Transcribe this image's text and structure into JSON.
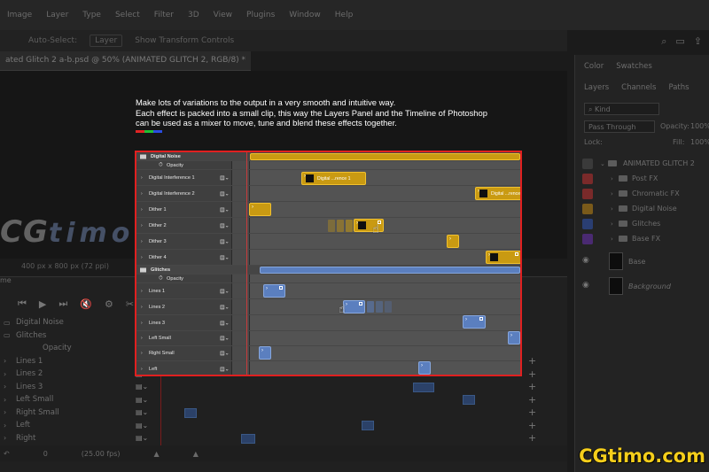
{
  "menubar": {
    "items": [
      "Image",
      "Layer",
      "Type",
      "Select",
      "Filter",
      "3D",
      "View",
      "Plugins",
      "Window",
      "Help"
    ]
  },
  "options_bar": {
    "auto_select": "Auto-Select:",
    "layer_select": "Layer",
    "show_transform": "Show Transform Controls"
  },
  "document": {
    "tab_title": "ated Glitch 2 a-b.psd @ 50% (ANIMATED GLITCH 2, RGB/8) *",
    "status": "400 px x 800 px (72 ppi)"
  },
  "left_watermark": {
    "cg": "CG",
    "timo": "timo"
  },
  "description": {
    "line1": "Make lots of variations to the output in a very smooth and intuitive way.",
    "line2": "Each effect is packed into a small clip, this way the Layers Panel and the Timeline of Photoshop",
    "line3": "can be used as a mixer to move, tune and blend these effects together.",
    "rgb_colors": [
      "#e02424",
      "#22c033",
      "#2a4de0"
    ]
  },
  "inset_timeline": {
    "rows": [
      {
        "label": "Digital Noise",
        "type": "group"
      },
      {
        "label": "Opacity",
        "type": "opacity"
      },
      {
        "label": "Digital Interference 1",
        "type": "layer"
      },
      {
        "label": "Digital Interference 2",
        "type": "layer"
      },
      {
        "label": "Dither 1",
        "type": "layer"
      },
      {
        "label": "Dither 2",
        "type": "layer"
      },
      {
        "label": "Dither 3",
        "type": "layer"
      },
      {
        "label": "Dither 4",
        "type": "layer"
      },
      {
        "label": "Glitches",
        "type": "group"
      },
      {
        "label": "Opacity",
        "type": "opacity"
      },
      {
        "label": "Lines 1",
        "type": "layer"
      },
      {
        "label": "Lines 2",
        "type": "layer"
      },
      {
        "label": "Lines 3",
        "type": "layer"
      },
      {
        "label": "Left Small",
        "type": "layer"
      },
      {
        "label": "Right Small",
        "type": "layer"
      },
      {
        "label": "Left",
        "type": "layer"
      }
    ],
    "clip_labels": {
      "di1": "Digital ...rence 1",
      "di2": "Digital ...rence"
    },
    "colors": {
      "yellow_clip": "#c99a12",
      "blue_clip": "#5b7fbf",
      "border": "#e02020"
    }
  },
  "bg_timeline": {
    "tab": "me",
    "rows": [
      {
        "label": "Digital Noise",
        "kind": "group"
      },
      {
        "label": "Glitches",
        "kind": "group"
      },
      {
        "label": "Opacity",
        "kind": "opacity"
      },
      {
        "label": "Lines 1",
        "kind": "layer"
      },
      {
        "label": "Lines 2",
        "kind": "layer"
      },
      {
        "label": "Lines 3",
        "kind": "layer"
      },
      {
        "label": "Left Small",
        "kind": "layer"
      },
      {
        "label": "Right Small",
        "kind": "layer"
      },
      {
        "label": "Left",
        "kind": "layer"
      },
      {
        "label": "Right",
        "kind": "layer"
      }
    ],
    "bottom": {
      "frame": "0",
      "fps": "(25.00 fps)"
    }
  },
  "right_panel": {
    "tabs_top": [
      "Color",
      "Swatches"
    ],
    "tabs": [
      "Layers",
      "Channels",
      "Paths"
    ],
    "kind": "Kind",
    "blend_mode": "Pass Through",
    "opacity_label": "Opacity:",
    "opacity_value": "100%",
    "lock_label": "Lock:",
    "fill_label": "Fill:",
    "fill_value": "100%",
    "group_name": "ANIMATED GLITCH 2",
    "layers": [
      {
        "name": "Post FX",
        "color": "#7a2a2a"
      },
      {
        "name": "Chromatic FX",
        "color": "#7a2a2a"
      },
      {
        "name": "Digital Noise",
        "color": "#7a5a1a"
      },
      {
        "name": "Glitches",
        "color": "#2a3e72"
      },
      {
        "name": "Base FX",
        "color": "#4a2a72"
      }
    ],
    "base_layers": [
      "Base",
      "Background"
    ]
  },
  "bottom_watermark": "CGtimo.com"
}
